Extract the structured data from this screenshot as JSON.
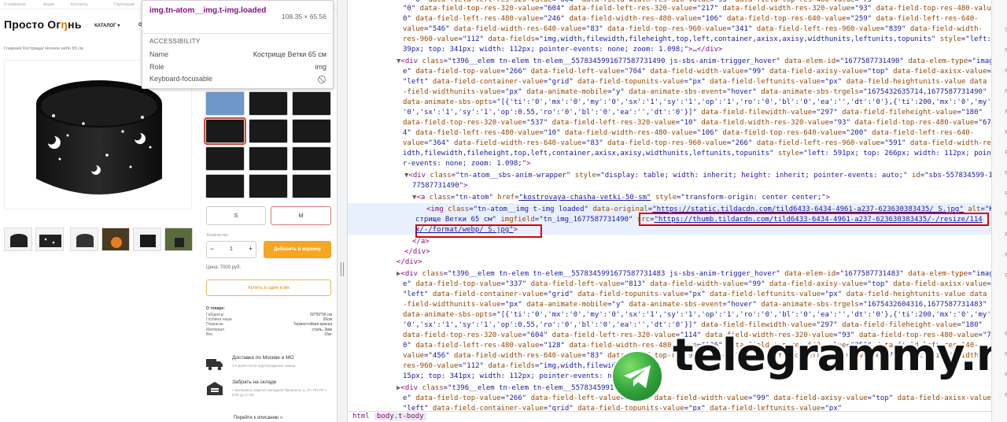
{
  "site": {
    "top_links": [
      "О компании",
      "Акции",
      "Контакты",
      "Партнерам"
    ],
    "logo_text": "Просто Ог",
    "logo_fire": "ŋ",
    "logo_end": "нь",
    "nav_catalog": "КАТАЛОГ",
    "nav_o": "О",
    "breadcrumb": "Главная/ Кострища/ Ночное небо 65 см",
    "sizes": [
      "S",
      "M"
    ],
    "qty_label": "Количество",
    "qty_minus": "−",
    "qty_value": "1",
    "qty_plus": "+",
    "add_to_cart": "Добавить в корзину",
    "price": "Цена: 7000 руб.",
    "one_click": "Купить в один клик",
    "specs_title": "О товаре:",
    "specs": [
      {
        "k": "Габариты",
        "v": "50*50*56 см"
      },
      {
        "k": "Глубина чаши",
        "v": "26см"
      },
      {
        "k": "Покраска",
        "v": "Термостойкая краска"
      },
      {
        "k": "Материал",
        "v": "сталь, 3мм"
      },
      {
        "k": "Вес",
        "v": "15кг"
      }
    ],
    "delivery_title": "Доставка по Москве и МО",
    "delivery_sub": "3-5 дней после подтверждения заказа",
    "pickup_title": "Забрать на складе",
    "pickup_sub": "г. Балашиха, квартал Западная Промзона, д. 2А, ПН-ПТ с 8:00 до 17:00",
    "to_description": "Перейти к описанию »"
  },
  "tooltip": {
    "tag": "img.tn-atom__img.t-img.loaded",
    "dims": "108.35 × 65.56",
    "section": "ACCESSIBILITY",
    "name_label": "Name",
    "name_value": "Кострище Ветки 65 см",
    "role_label": "Role",
    "role_value": "img",
    "focus_label": "Keyboard-focusable"
  },
  "devtools": {
    "breadcrumbs": [
      "html",
      "body.t-body"
    ],
    "right_strip_letters": [
      "S",
      "F",
      "F",
      "F",
      "F",
      "F",
      "F",
      "P",
      "P",
      "P",
      "P",
      "P",
      "P",
      "P",
      "P",
      "P",
      "P",
      "P",
      "P",
      "P",
      "P"
    ]
  },
  "watermark": {
    "text": "telegrammy.net"
  }
}
